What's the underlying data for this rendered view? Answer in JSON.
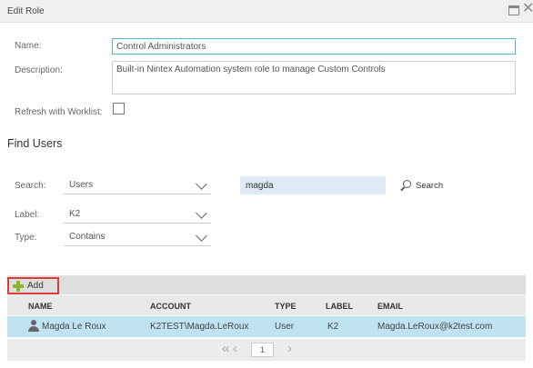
{
  "window": {
    "title": "Edit Role"
  },
  "role": {
    "name_label": "Name:",
    "name_value": "Control Administrators",
    "description_label": "Description:",
    "description_value": "Built-in Nintex Automation system role to manage Custom Controls",
    "refresh_label": "Refresh with Worklist:",
    "refresh_checked": false
  },
  "find_users": {
    "title": "Find Users",
    "search_label": "Search:",
    "search_type": "Users",
    "search_value": "magda",
    "search_button": "Search",
    "label_label": "Label:",
    "label_value": "K2",
    "type_label": "Type:",
    "type_value": "Contains"
  },
  "results": {
    "add_label": "Add",
    "columns": [
      "NAME",
      "ACCOUNT",
      "TYPE",
      "LABEL",
      "EMAIL"
    ],
    "rows": [
      {
        "name": "Magda Le Roux",
        "account": "K2TEST\\Magda.LeRoux",
        "type": "User",
        "label": "K2",
        "email": "Magda.LeRoux@k2test.com"
      }
    ],
    "pager": {
      "first": "«",
      "prev": "‹",
      "page": "1",
      "next": "›"
    }
  },
  "icons": [
    "maximize-icon",
    "close-icon",
    "search-icon",
    "add-icon",
    "user-icon",
    "chevron-down-icon"
  ],
  "colors": {
    "accent": "#5bb5d5",
    "selected_row": "#bfe3f3",
    "add_icon": "#8ab52d",
    "highlight_border": "#e03b3b",
    "search_input_bg": "#dfeaf6"
  }
}
